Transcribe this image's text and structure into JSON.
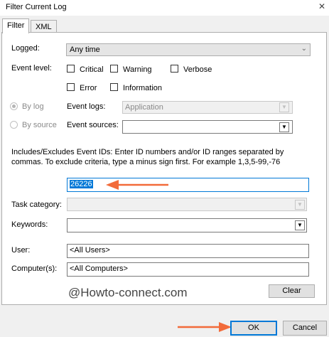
{
  "window": {
    "title": "Filter Current Log",
    "close_glyph": "✕"
  },
  "tabs": [
    {
      "label": "Filter"
    },
    {
      "label": "XML"
    }
  ],
  "filter": {
    "logged_label": "Logged:",
    "logged_value": "Any time",
    "event_level_label": "Event level:",
    "levels": [
      "Critical",
      "Warning",
      "Verbose",
      "Error",
      "Information"
    ],
    "by_log_label": "By log",
    "by_source_label": "By source",
    "event_logs_label": "Event logs:",
    "event_logs_value": "Application",
    "event_sources_label": "Event sources:",
    "event_sources_value": "",
    "ids_help": "Includes/Excludes Event IDs: Enter ID numbers and/or ID ranges separated by commas. To exclude criteria, type a minus sign first. For example 1,3,5-99,-76",
    "event_id_value": "26226",
    "task_category_label": "Task category:",
    "keywords_label": "Keywords:",
    "user_label": "User:",
    "user_value": "<All Users>",
    "computer_label": "Computer(s):",
    "computer_value": "<All Computers>",
    "clear_label": "Clear"
  },
  "watermark": "@Howto-connect.com",
  "footer": {
    "ok_label": "OK",
    "cancel_label": "Cancel"
  },
  "colors": {
    "arrow": "#f26b3a",
    "selection": "#0078d7",
    "primary_border": "#0078d7"
  }
}
